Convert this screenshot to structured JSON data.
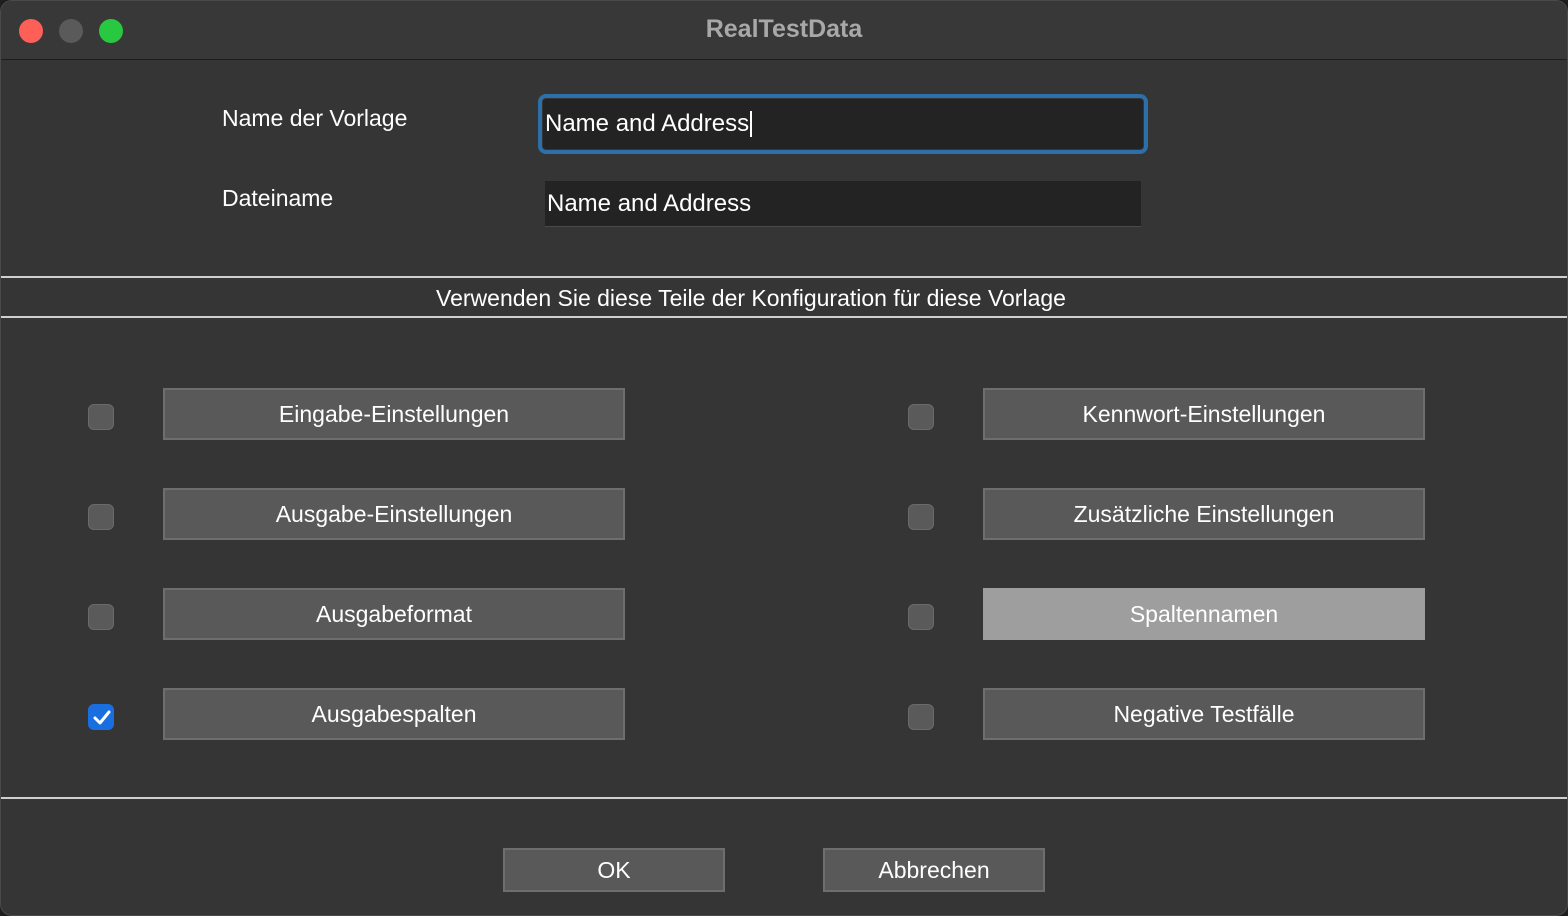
{
  "window": {
    "title": "RealTestData"
  },
  "form": {
    "template_name_label": "Name der Vorlage",
    "template_name_value": "Name and Address",
    "filename_label": "Dateiname",
    "filename_value": "Name and Address"
  },
  "section": {
    "title": "Verwenden Sie diese Teile der Konfiguration für diese Vorlage"
  },
  "options": {
    "left": [
      {
        "label": "Eingabe-Einstellungen",
        "checked": false
      },
      {
        "label": "Ausgabe-Einstellungen",
        "checked": false
      },
      {
        "label": "Ausgabeformat",
        "checked": false
      },
      {
        "label": "Ausgabespalten",
        "checked": true
      }
    ],
    "right": [
      {
        "label": "Kennwort-Einstellungen",
        "checked": false
      },
      {
        "label": "Zusätzliche Einstellungen",
        "checked": false
      },
      {
        "label": "Spaltennamen",
        "checked": false
      },
      {
        "label": "Negative Testfälle",
        "checked": false
      }
    ]
  },
  "footer": {
    "ok_label": "OK",
    "cancel_label": "Abbrechen"
  },
  "colors": {
    "checkbox_checked": "#1a6fe0",
    "focus_ring": "#2d6fa8"
  }
}
